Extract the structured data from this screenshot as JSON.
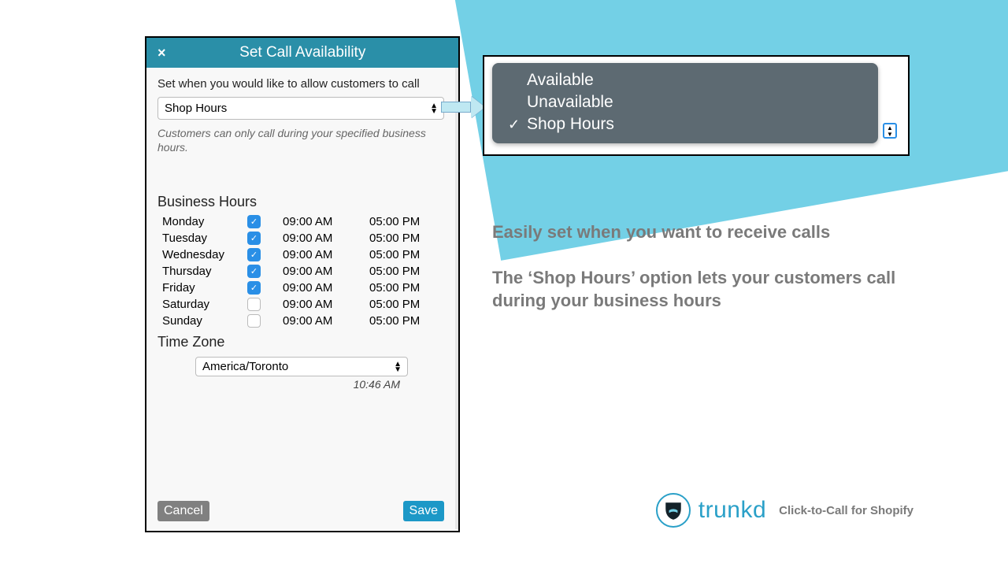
{
  "panel": {
    "title": "Set Call Availability",
    "lead": "Set when you would like to allow customers to call",
    "availability_selected": "Shop Hours",
    "helper": "Customers can only call during your specified business hours.",
    "business_hours_heading": "Business Hours",
    "days": [
      {
        "name": "Monday",
        "enabled": true,
        "open": "09:00 AM",
        "close": "05:00 PM"
      },
      {
        "name": "Tuesday",
        "enabled": true,
        "open": "09:00 AM",
        "close": "05:00 PM"
      },
      {
        "name": "Wednesday",
        "enabled": true,
        "open": "09:00 AM",
        "close": "05:00 PM"
      },
      {
        "name": "Thursday",
        "enabled": true,
        "open": "09:00 AM",
        "close": "05:00 PM"
      },
      {
        "name": "Friday",
        "enabled": true,
        "open": "09:00 AM",
        "close": "05:00 PM"
      },
      {
        "name": "Saturday",
        "enabled": false,
        "open": "09:00 AM",
        "close": "05:00 PM"
      },
      {
        "name": "Sunday",
        "enabled": false,
        "open": "09:00 AM",
        "close": "05:00 PM"
      }
    ],
    "timezone_heading": "Time Zone",
    "timezone_selected": "America/Toronto",
    "current_time": "10:46 AM",
    "cancel_label": "Cancel",
    "save_label": "Save"
  },
  "dropdown": {
    "options": [
      {
        "label": "Available",
        "selected": false
      },
      {
        "label": "Unavailable",
        "selected": false
      },
      {
        "label": "Shop Hours",
        "selected": true
      }
    ]
  },
  "marketing": {
    "line1": "Easily set when you want to receive calls",
    "line2": "The ‘Shop Hours’ option lets your customers call during your business hours"
  },
  "brand": {
    "name": "trunkd",
    "tagline": "Click-to-Call for Shopify"
  }
}
